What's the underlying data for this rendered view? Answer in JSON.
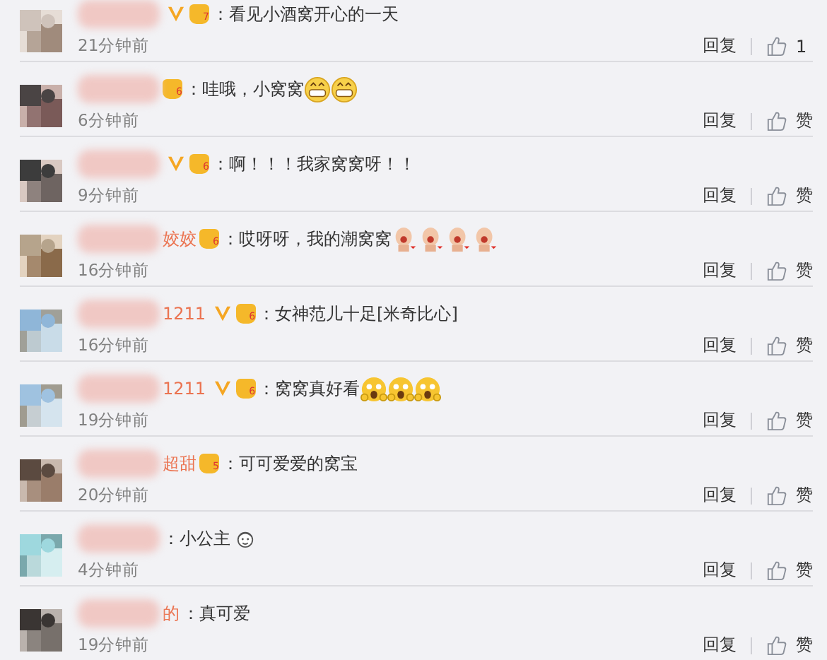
{
  "comments": [
    {
      "avatar": {
        "kind": "picture"
      },
      "verified": true,
      "badge": "7",
      "text": "：看见小酒窝开心的一天",
      "time": "21分钟前",
      "reply": "回复",
      "like": "1"
    },
    {
      "avatar": {
        "kind": "picture"
      },
      "verified": false,
      "badge": "6",
      "text": "：哇哦，小窝窝",
      "emojis": [
        {
          "kind": "grin"
        },
        {
          "kind": "grin"
        }
      ],
      "time": "6分钟前",
      "reply": "回复",
      "like": "赞"
    },
    {
      "avatar": {
        "kind": "picture"
      },
      "verified": true,
      "badge": "6",
      "text": "：啊！！！我家窝窝呀！！",
      "time": "9分钟前",
      "reply": "回复",
      "like": "赞"
    },
    {
      "avatar": {
        "kind": "picture"
      },
      "name": "姣姣",
      "verified": false,
      "badge": "6",
      "text": "：哎呀呀，我的潮窝窝",
      "emojis": [
        {
          "kind": "baby"
        },
        {
          "kind": "baby"
        },
        {
          "kind": "baby"
        },
        {
          "kind": "baby"
        }
      ],
      "time": "16分钟前",
      "reply": "回复",
      "like": "赞"
    },
    {
      "avatar": {
        "kind": "picture"
      },
      "name": "1211",
      "verified": true,
      "badge": "6",
      "text": "：女神范儿十足[米奇比心]",
      "time": "16分钟前",
      "reply": "回复",
      "like": "赞"
    },
    {
      "avatar": {
        "kind": "picture"
      },
      "name": "1211",
      "verified": true,
      "badge": "6",
      "text": "：窝窝真好看",
      "emojis": [
        {
          "kind": "shocked"
        },
        {
          "kind": "shocked"
        },
        {
          "kind": "shocked"
        }
      ],
      "time": "19分钟前",
      "reply": "回复",
      "like": "赞"
    },
    {
      "avatar": {
        "kind": "picture"
      },
      "name": "超甜",
      "verified": false,
      "badge": "5",
      "text": "：可可爱爱的窝宝",
      "time": "20分钟前",
      "reply": "回复",
      "like": "赞"
    },
    {
      "avatar": {
        "kind": "picture"
      },
      "verified": false,
      "text": "：小公主",
      "emojis": [
        {
          "kind": "face"
        }
      ],
      "time": "4分钟前",
      "reply": "回复",
      "like": "赞"
    },
    {
      "avatar": {
        "kind": "picture"
      },
      "name": "的",
      "verified": false,
      "text": "：真可爱",
      "time": "19分钟前",
      "reply": "回复",
      "like": "赞"
    }
  ]
}
